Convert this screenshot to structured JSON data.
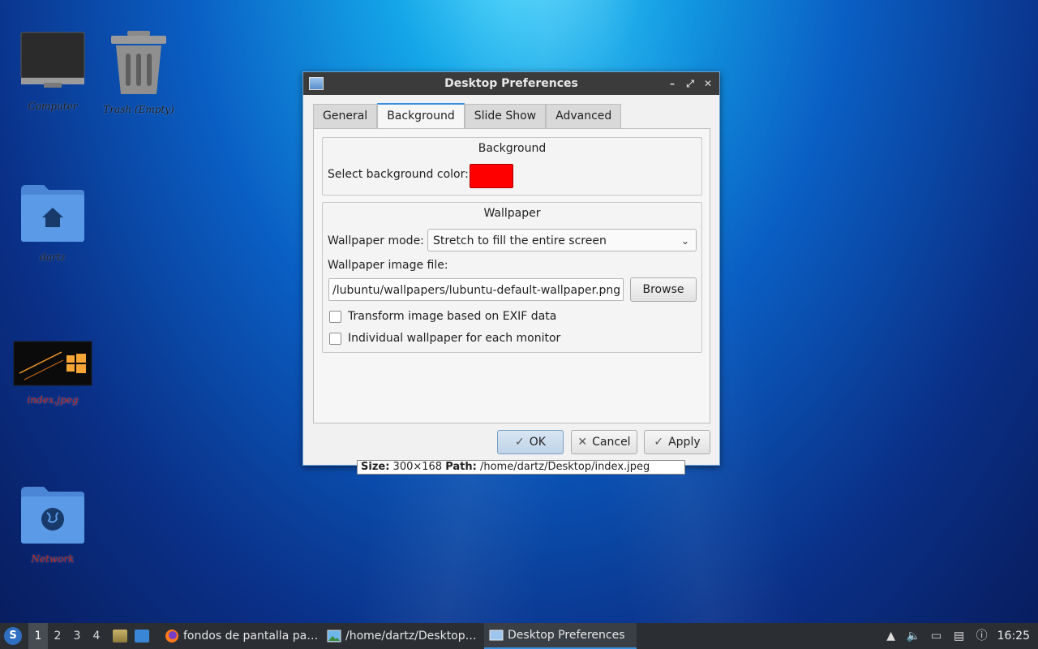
{
  "desktop": {
    "icons": [
      {
        "label": "Computer"
      },
      {
        "label": "Trash (Empty)"
      },
      {
        "label": "dartz"
      },
      {
        "label": "index.jpeg"
      },
      {
        "label": "Network"
      }
    ]
  },
  "dialog": {
    "title": "Desktop Preferences",
    "tabs": [
      {
        "label": "General"
      },
      {
        "label": "Background"
      },
      {
        "label": "Slide Show"
      },
      {
        "label": "Advanced"
      }
    ],
    "active_tab": "Background",
    "background_group": {
      "title": "Background",
      "color_label": "Select background color:",
      "color_value": "#ff0000"
    },
    "wallpaper_group": {
      "title": "Wallpaper",
      "mode_label": "Wallpaper mode:",
      "mode_value": "Stretch to fill the entire screen",
      "file_label": "Wallpaper image file:",
      "file_value": "/lubuntu/wallpapers/lubuntu-default-wallpaper.png",
      "browse_label": "Browse",
      "exif_label": "Transform image based on EXIF data",
      "exif_checked": false,
      "per_monitor_label": "Individual wallpaper for each monitor",
      "per_monitor_checked": false
    },
    "buttons": {
      "ok": "OK",
      "cancel": "Cancel",
      "apply": "Apply"
    }
  },
  "tooltip": {
    "size_key": "Size:",
    "size_value": "300×168",
    "path_key": "Path:",
    "path_value": "/home/dartz/Desktop/index.jpeg"
  },
  "taskbar": {
    "workspaces": [
      "1",
      "2",
      "3",
      "4"
    ],
    "active_workspace": "1",
    "tasks": [
      {
        "label": "fondos de pantalla pa…",
        "icon": "firefox-icon"
      },
      {
        "label": "/home/dartz/Desktop…",
        "icon": "image-viewer-icon"
      },
      {
        "label": "Desktop Preferences",
        "icon": "window-icon"
      }
    ],
    "clock": "16:25"
  }
}
